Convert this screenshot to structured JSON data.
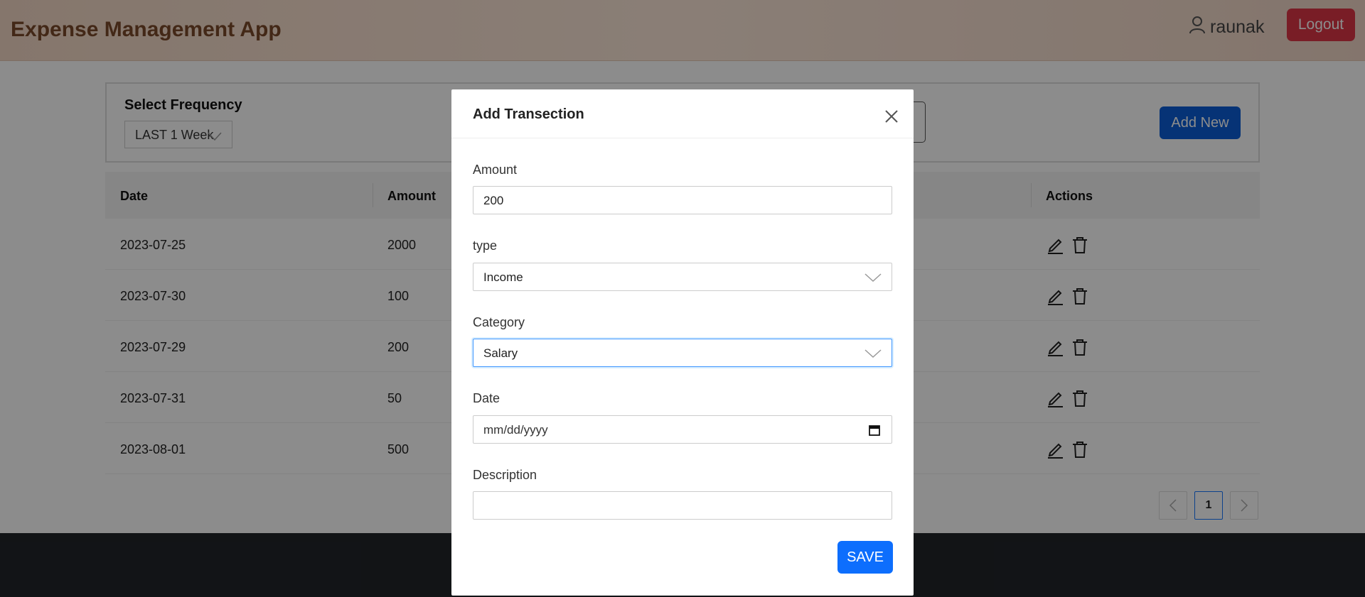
{
  "app": {
    "title": "Expense Management App"
  },
  "header": {
    "username": "raunak",
    "logout_label": "Logout"
  },
  "filters": {
    "frequency_label": "Select Frequency",
    "frequency_value": "LAST 1 Week",
    "add_new_label": "Add New"
  },
  "table": {
    "columns": [
      "Date",
      "Amount",
      "Actions"
    ],
    "rows": [
      {
        "date": "2023-07-25",
        "amount": "2000"
      },
      {
        "date": "2023-07-30",
        "amount": "100"
      },
      {
        "date": "2023-07-29",
        "amount": "200"
      },
      {
        "date": "2023-07-31",
        "amount": "50"
      },
      {
        "date": "2023-08-01",
        "amount": "500"
      }
    ]
  },
  "pagination": {
    "current_page": "1"
  },
  "modal": {
    "title": "Add Transection",
    "amount_label": "Amount",
    "amount_value": "200",
    "type_label": "type",
    "type_value": "Income",
    "category_label": "Category",
    "category_value": "Salary",
    "date_label": "Date",
    "date_placeholder": "mm/dd/yyyy",
    "description_label": "Description",
    "description_value": "",
    "save_label": "SAVE"
  },
  "colors": {
    "danger": "#dc3545",
    "primary": "#0d6efd",
    "brand_text": "#7a4a2a",
    "footer": "#212529"
  }
}
